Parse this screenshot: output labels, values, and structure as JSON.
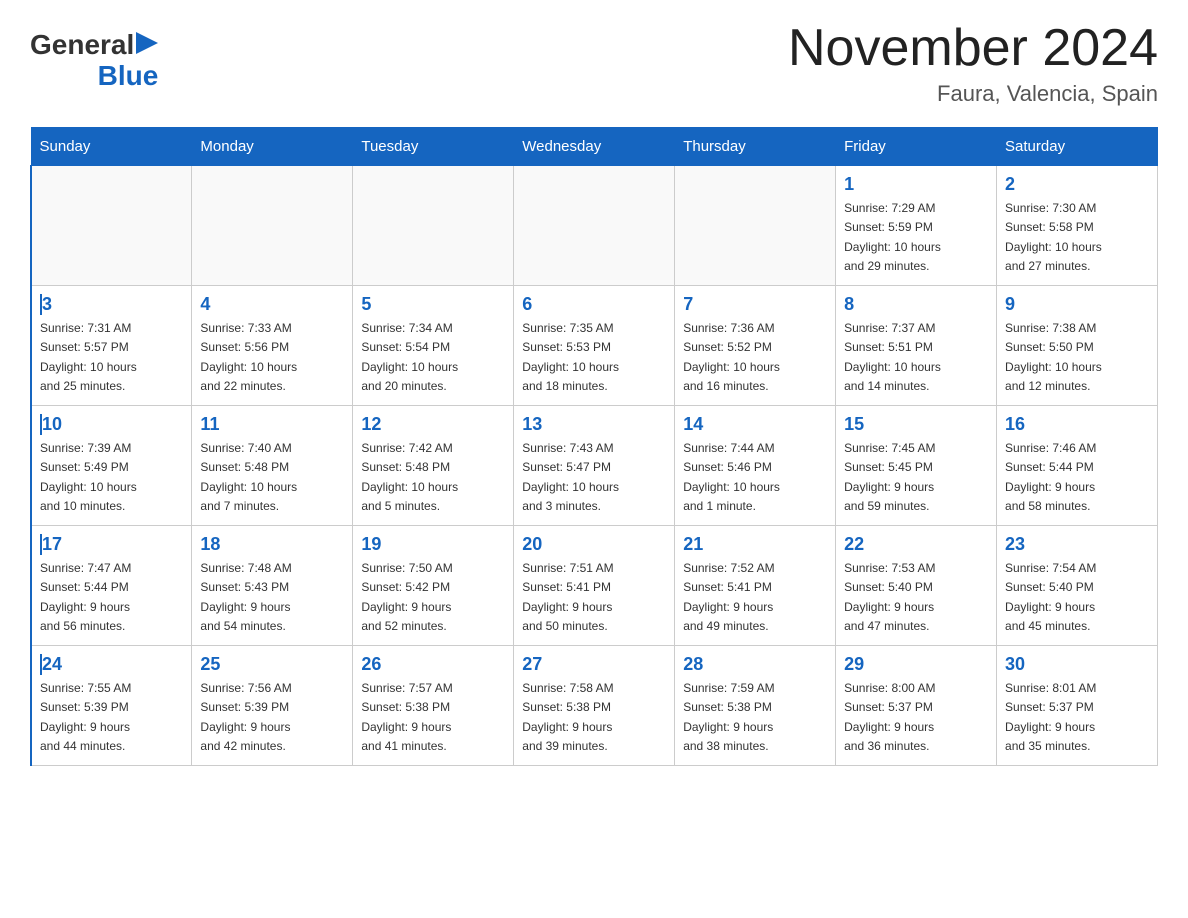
{
  "header": {
    "logo_general": "General",
    "logo_blue": "Blue",
    "title": "November 2024",
    "subtitle": "Faura, Valencia, Spain"
  },
  "weekdays": [
    "Sunday",
    "Monday",
    "Tuesday",
    "Wednesday",
    "Thursday",
    "Friday",
    "Saturday"
  ],
  "weeks": [
    [
      {
        "day": "",
        "info": ""
      },
      {
        "day": "",
        "info": ""
      },
      {
        "day": "",
        "info": ""
      },
      {
        "day": "",
        "info": ""
      },
      {
        "day": "",
        "info": ""
      },
      {
        "day": "1",
        "info": "Sunrise: 7:29 AM\nSunset: 5:59 PM\nDaylight: 10 hours\nand 29 minutes."
      },
      {
        "day": "2",
        "info": "Sunrise: 7:30 AM\nSunset: 5:58 PM\nDaylight: 10 hours\nand 27 minutes."
      }
    ],
    [
      {
        "day": "3",
        "info": "Sunrise: 7:31 AM\nSunset: 5:57 PM\nDaylight: 10 hours\nand 25 minutes."
      },
      {
        "day": "4",
        "info": "Sunrise: 7:33 AM\nSunset: 5:56 PM\nDaylight: 10 hours\nand 22 minutes."
      },
      {
        "day": "5",
        "info": "Sunrise: 7:34 AM\nSunset: 5:54 PM\nDaylight: 10 hours\nand 20 minutes."
      },
      {
        "day": "6",
        "info": "Sunrise: 7:35 AM\nSunset: 5:53 PM\nDaylight: 10 hours\nand 18 minutes."
      },
      {
        "day": "7",
        "info": "Sunrise: 7:36 AM\nSunset: 5:52 PM\nDaylight: 10 hours\nand 16 minutes."
      },
      {
        "day": "8",
        "info": "Sunrise: 7:37 AM\nSunset: 5:51 PM\nDaylight: 10 hours\nand 14 minutes."
      },
      {
        "day": "9",
        "info": "Sunrise: 7:38 AM\nSunset: 5:50 PM\nDaylight: 10 hours\nand 12 minutes."
      }
    ],
    [
      {
        "day": "10",
        "info": "Sunrise: 7:39 AM\nSunset: 5:49 PM\nDaylight: 10 hours\nand 10 minutes."
      },
      {
        "day": "11",
        "info": "Sunrise: 7:40 AM\nSunset: 5:48 PM\nDaylight: 10 hours\nand 7 minutes."
      },
      {
        "day": "12",
        "info": "Sunrise: 7:42 AM\nSunset: 5:48 PM\nDaylight: 10 hours\nand 5 minutes."
      },
      {
        "day": "13",
        "info": "Sunrise: 7:43 AM\nSunset: 5:47 PM\nDaylight: 10 hours\nand 3 minutes."
      },
      {
        "day": "14",
        "info": "Sunrise: 7:44 AM\nSunset: 5:46 PM\nDaylight: 10 hours\nand 1 minute."
      },
      {
        "day": "15",
        "info": "Sunrise: 7:45 AM\nSunset: 5:45 PM\nDaylight: 9 hours\nand 59 minutes."
      },
      {
        "day": "16",
        "info": "Sunrise: 7:46 AM\nSunset: 5:44 PM\nDaylight: 9 hours\nand 58 minutes."
      }
    ],
    [
      {
        "day": "17",
        "info": "Sunrise: 7:47 AM\nSunset: 5:44 PM\nDaylight: 9 hours\nand 56 minutes."
      },
      {
        "day": "18",
        "info": "Sunrise: 7:48 AM\nSunset: 5:43 PM\nDaylight: 9 hours\nand 54 minutes."
      },
      {
        "day": "19",
        "info": "Sunrise: 7:50 AM\nSunset: 5:42 PM\nDaylight: 9 hours\nand 52 minutes."
      },
      {
        "day": "20",
        "info": "Sunrise: 7:51 AM\nSunset: 5:41 PM\nDaylight: 9 hours\nand 50 minutes."
      },
      {
        "day": "21",
        "info": "Sunrise: 7:52 AM\nSunset: 5:41 PM\nDaylight: 9 hours\nand 49 minutes."
      },
      {
        "day": "22",
        "info": "Sunrise: 7:53 AM\nSunset: 5:40 PM\nDaylight: 9 hours\nand 47 minutes."
      },
      {
        "day": "23",
        "info": "Sunrise: 7:54 AM\nSunset: 5:40 PM\nDaylight: 9 hours\nand 45 minutes."
      }
    ],
    [
      {
        "day": "24",
        "info": "Sunrise: 7:55 AM\nSunset: 5:39 PM\nDaylight: 9 hours\nand 44 minutes."
      },
      {
        "day": "25",
        "info": "Sunrise: 7:56 AM\nSunset: 5:39 PM\nDaylight: 9 hours\nand 42 minutes."
      },
      {
        "day": "26",
        "info": "Sunrise: 7:57 AM\nSunset: 5:38 PM\nDaylight: 9 hours\nand 41 minutes."
      },
      {
        "day": "27",
        "info": "Sunrise: 7:58 AM\nSunset: 5:38 PM\nDaylight: 9 hours\nand 39 minutes."
      },
      {
        "day": "28",
        "info": "Sunrise: 7:59 AM\nSunset: 5:38 PM\nDaylight: 9 hours\nand 38 minutes."
      },
      {
        "day": "29",
        "info": "Sunrise: 8:00 AM\nSunset: 5:37 PM\nDaylight: 9 hours\nand 36 minutes."
      },
      {
        "day": "30",
        "info": "Sunrise: 8:01 AM\nSunset: 5:37 PM\nDaylight: 9 hours\nand 35 minutes."
      }
    ]
  ]
}
